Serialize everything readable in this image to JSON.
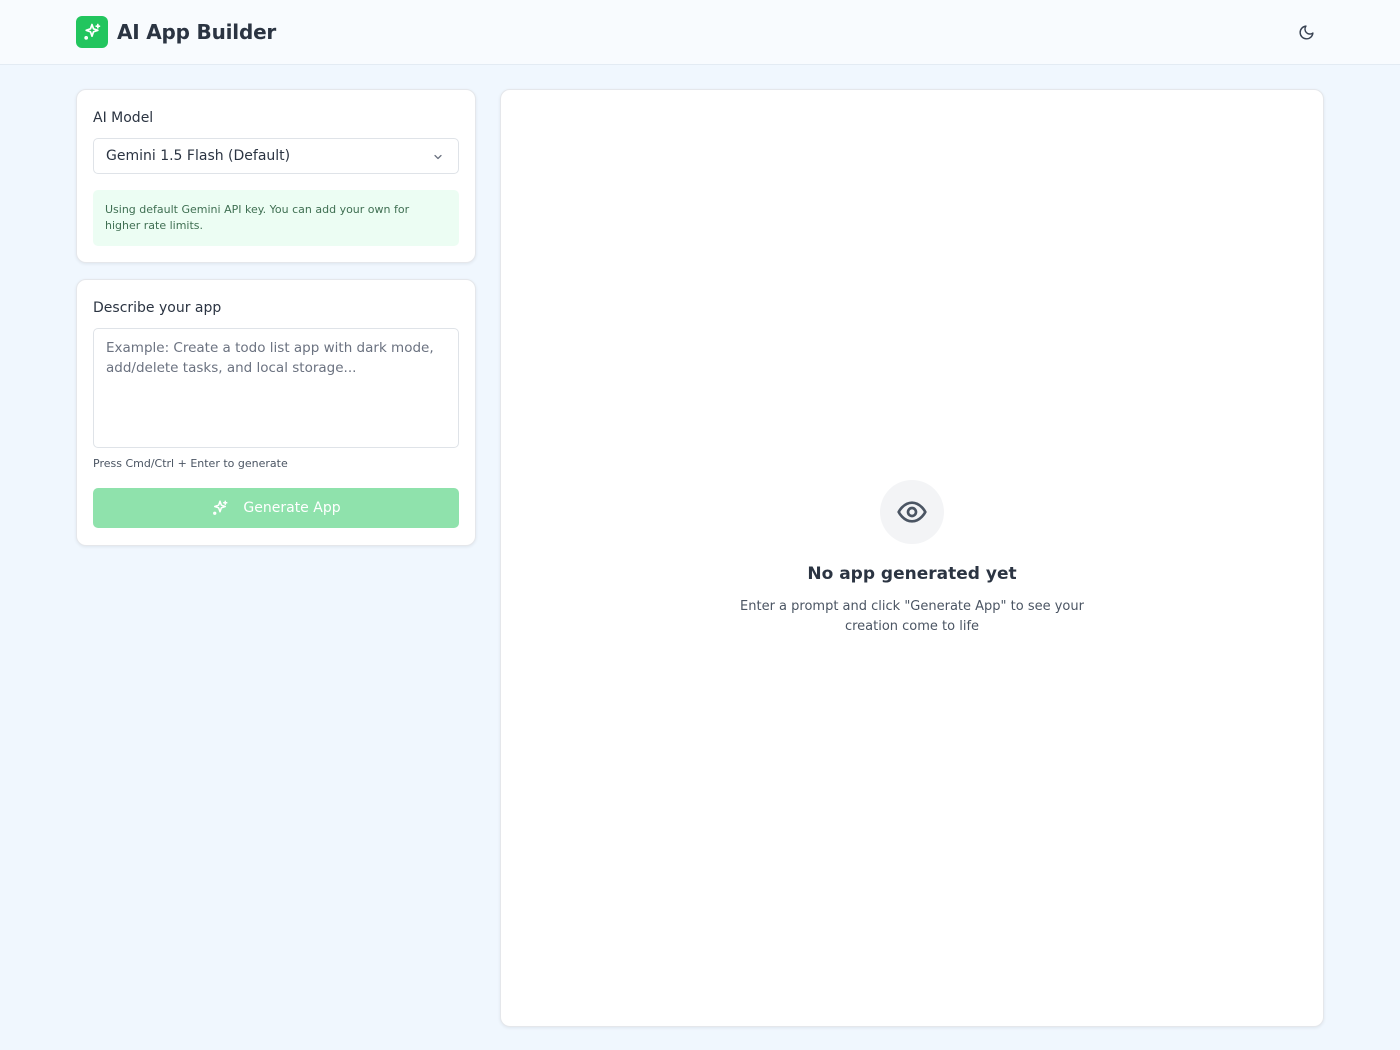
{
  "header": {
    "title": "AI App Builder",
    "logo_icon": "sparkles-icon",
    "theme_toggle_icon": "moon-icon"
  },
  "model_panel": {
    "label": "AI Model",
    "selected_model": "Gemini 1.5 Flash (Default)",
    "notice": "Using default Gemini API key. You can add your own for higher rate limits."
  },
  "describe_panel": {
    "label": "Describe your app",
    "placeholder": "Example: Create a todo list app with dark mode, add/delete tasks, and local storage...",
    "value": "",
    "hint": "Press Cmd/Ctrl + Enter to generate",
    "generate_label": "Generate App",
    "generate_icon": "sparkles-icon"
  },
  "preview": {
    "icon": "eye-icon",
    "title": "No app generated yet",
    "subtitle": "Enter a prompt and click \"Generate App\" to see your creation come to life"
  },
  "colors": {
    "brand": "#22c55e",
    "brand_disabled": "#8fe2ac",
    "page_background": "#f0f7fe",
    "notice_background": "#ecfdf3"
  }
}
